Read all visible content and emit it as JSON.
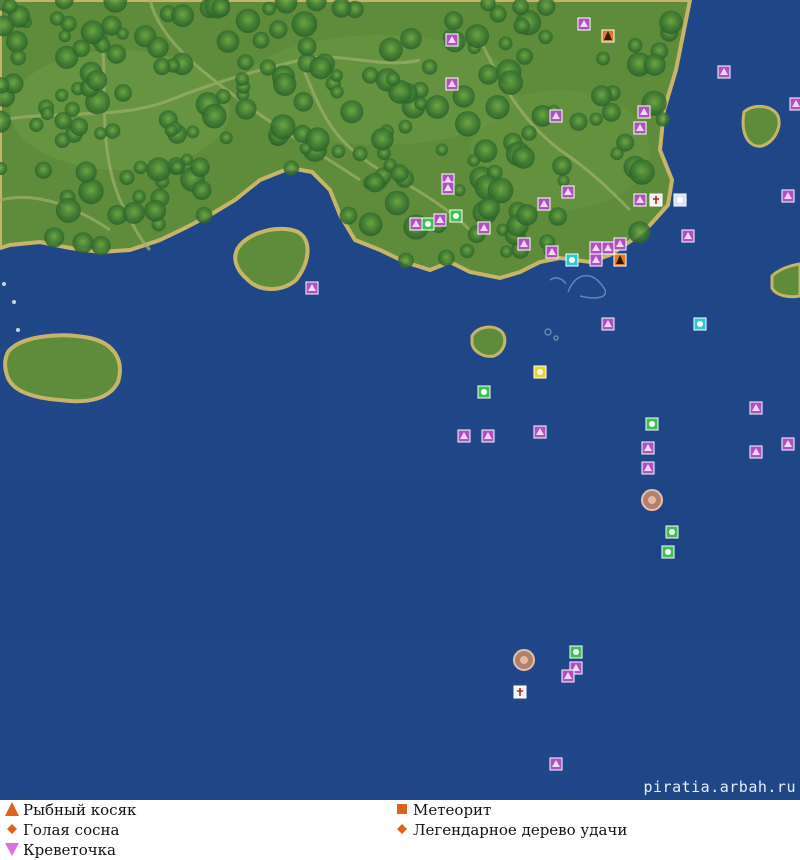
{
  "watermark": "piratia.arbah.ru",
  "colors": {
    "deep_water": "#1e4586",
    "shallow_water": "#24498c",
    "land": "#5f8d3a",
    "land_light": "#7aa350",
    "coast": "#b8a85a",
    "tree": "#2f6b2a",
    "marker_purple": "#b04fc0",
    "marker_green": "#3ec050",
    "marker_cyan": "#28c8d8",
    "marker_orange": "#e07a20"
  },
  "legend": [
    {
      "label": "Рыбный косяк",
      "icon": "orange-triangle-up-icon",
      "color": "#e0621a"
    },
    {
      "label": "Метеорит",
      "icon": "orange-square-icon",
      "color": "#e0621a"
    },
    {
      "label": "Голая сосна",
      "icon": "orange-diamond-icon",
      "color": "#e0621a"
    },
    {
      "label": "Легендарное дерево удачи",
      "icon": "orange-diamond-icon",
      "color": "#e0621a"
    },
    {
      "label": "Креветочка",
      "icon": "pink-triangle-down-icon",
      "color": "#e070e0"
    }
  ],
  "markers": {
    "purple": [
      [
        584,
        24
      ],
      [
        452,
        40
      ],
      [
        724,
        72
      ],
      [
        452,
        84
      ],
      [
        796,
        104
      ],
      [
        644,
        112
      ],
      [
        556,
        116
      ],
      [
        640,
        128
      ],
      [
        448,
        180
      ],
      [
        448,
        188
      ],
      [
        568,
        192
      ],
      [
        788,
        196
      ],
      [
        640,
        200
      ],
      [
        544,
        204
      ],
      [
        416,
        224
      ],
      [
        440,
        220
      ],
      [
        484,
        228
      ],
      [
        688,
        236
      ],
      [
        524,
        244
      ],
      [
        552,
        252
      ],
      [
        596,
        248
      ],
      [
        608,
        248
      ],
      [
        620,
        244
      ],
      [
        596,
        260
      ],
      [
        312,
        288
      ],
      [
        608,
        324
      ],
      [
        756,
        408
      ],
      [
        464,
        436
      ],
      [
        488,
        436
      ],
      [
        540,
        432
      ],
      [
        788,
        444
      ],
      [
        648,
        448
      ],
      [
        756,
        452
      ],
      [
        648,
        468
      ],
      [
        576,
        668
      ],
      [
        568,
        676
      ],
      [
        556,
        764
      ]
    ],
    "green": [
      [
        428,
        224
      ],
      [
        456,
        216
      ],
      [
        484,
        392
      ],
      [
        652,
        424
      ],
      [
        672,
        532
      ],
      [
        668,
        552
      ],
      [
        576,
        652
      ]
    ],
    "cyan": [
      [
        572,
        260
      ],
      [
        700,
        324
      ]
    ],
    "orange": [
      [
        608,
        36
      ],
      [
        620,
        260
      ]
    ],
    "white": [
      [
        656,
        200
      ],
      [
        520,
        692
      ]
    ],
    "yellow": [
      [
        540,
        372
      ]
    ],
    "blue_special": [
      [
        680,
        200
      ]
    ],
    "wreck": [
      [
        652,
        500
      ],
      [
        524,
        660
      ]
    ]
  }
}
